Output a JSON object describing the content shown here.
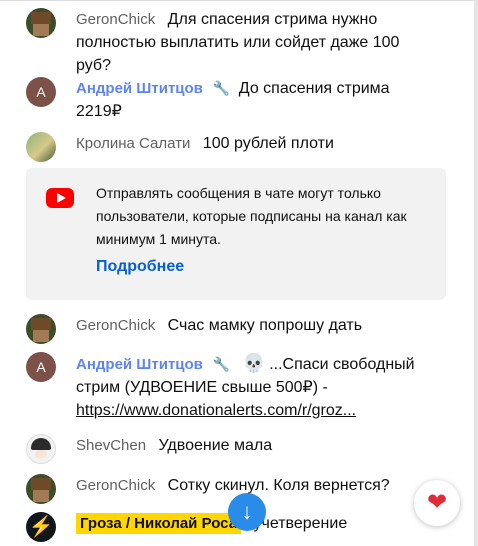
{
  "messages": [
    {
      "author": "GeronChick",
      "text": "Для спасения стрима нужно полностью выплатить или сойдет даже 100 руб?"
    },
    {
      "author": "Андрей Штитцов",
      "avatar_letter": "А",
      "text": "До спасения стрима 2219₽"
    },
    {
      "author": "Кролина Салати",
      "text": "100 рублей плоти"
    },
    {
      "author": "GeronChick",
      "text": "Счас мамку попрошу дать"
    },
    {
      "author": "Андрей Штитцов",
      "avatar_letter": "А",
      "text_prefix": "...Спаси свободный стрим (УДВОЕНИЕ свыше 500₽) - ",
      "link": "https://www.donationalerts.com/r/groz..."
    },
    {
      "author": "ShevChen",
      "text": "Удвоение мала"
    },
    {
      "author": "GeronChick",
      "text": "Сотку скинул. Коля вернется?"
    },
    {
      "author": "Гроза / Николай Роса",
      "text": "учетверение"
    }
  ],
  "notice": {
    "text": "Отправлять сообщения в чате могут только пользователи, которые подписаны на канал как минимум 1 минута.",
    "link_label": "Подробнее"
  },
  "icons": {
    "wrench": "wrench-icon",
    "skull": "skull-icon",
    "scroll_down": "arrow-down-icon",
    "heart": "heart-icon",
    "youtube": "youtube-logo-icon"
  },
  "colors": {
    "owner_name": "#5e84f1",
    "member_badge": "#ffd600",
    "link_blue": "#065fd4",
    "scroll_button": "#2b8be8"
  }
}
